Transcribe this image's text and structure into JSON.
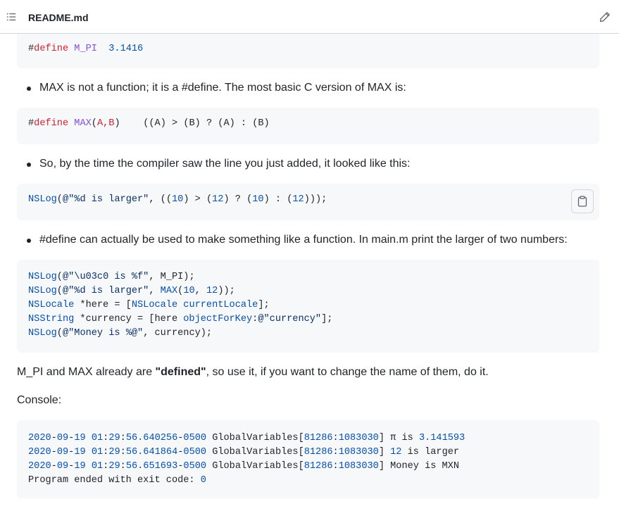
{
  "header": {
    "title": "README.md",
    "toc_icon": "list-unordered-icon",
    "edit_icon": "pencil-icon"
  },
  "code1": {
    "kw": "define",
    "hash": "#",
    "name": "M_PI",
    "value": "3.1416"
  },
  "bullet1": "MAX is not a function; it is a #define. The most basic C version of MAX is:",
  "code2": {
    "hash": "#",
    "kw": "define",
    "name": "MAX",
    "params": "A,B",
    "body": "((A) > (B) ? (A) : (B)"
  },
  "bullet2": "So, by the time the compiler saw the line you just added, it looked like this:",
  "code3": {
    "line": "NSLog(@\"%d is larger\", ((10) > (12) ? (10) : (12)));",
    "copy_icon": "clipboard-icon"
  },
  "bullet3": "#define can actually be used to make something like a function. In main.m print the larger of two numbers:",
  "code4": {
    "lines": [
      "NSLog(@\"\\u03c0 is %f\", M_PI);",
      "NSLog(@\"%d is larger\", MAX(10, 12));",
      "NSLocale *here = [NSLocale currentLocale];",
      "NSString *currency = [here objectForKey:@\"currency\"];",
      "NSLog(@\"Money is %@\", currency);"
    ]
  },
  "para1": {
    "before": "M_PI and MAX already are ",
    "bold": "\"defined\"",
    "after": ", so use it, if you want to change the name of them, do it."
  },
  "para2": "Console:",
  "console": {
    "lines": [
      {
        "date": "2020-09-19",
        "time": "01:29:56.640256-0500",
        "proc": "GlobalVariables[81286:1083030]",
        "msg": "π is 3.141593"
      },
      {
        "date": "2020-09-19",
        "time": "01:29:56.641864-0500",
        "proc": "GlobalVariables[81286:1083030]",
        "msg": "12 is larger"
      },
      {
        "date": "2020-09-19",
        "time": "01:29:56.651693-0500",
        "proc": "GlobalVariables[81286:1083030]",
        "msg": "Money is MXN"
      },
      {
        "date": "",
        "time": "",
        "proc": "",
        "msg": "Program ended with exit code: 0"
      }
    ]
  }
}
